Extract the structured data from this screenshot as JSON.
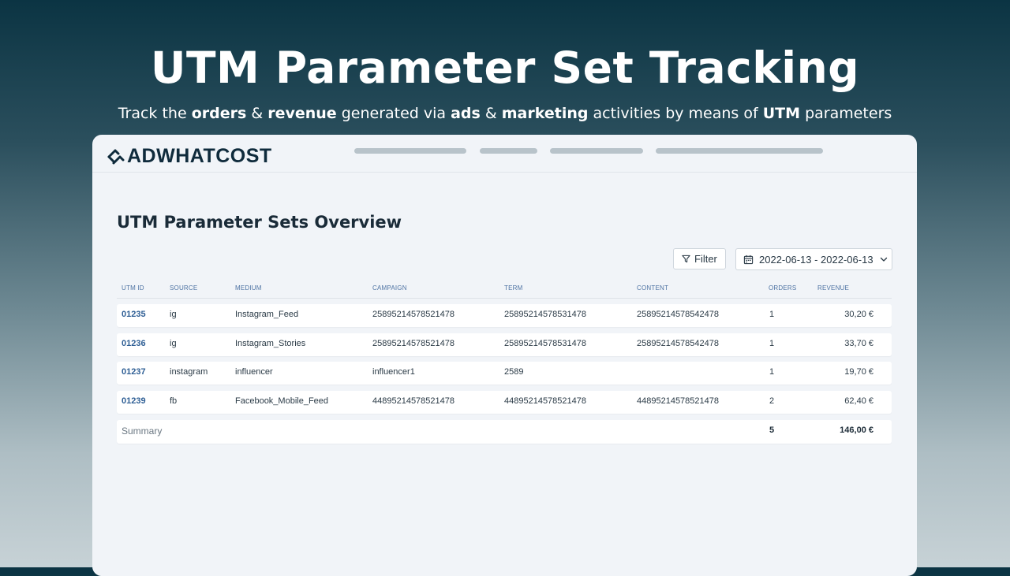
{
  "hero": {
    "title": "UTM Parameter Set Tracking",
    "subtitle_parts": [
      {
        "text": "Track the ",
        "bold": false
      },
      {
        "text": "orders",
        "bold": true
      },
      {
        "text": " & ",
        "bold": false
      },
      {
        "text": "revenue",
        "bold": true
      },
      {
        "text": " generated via ",
        "bold": false
      },
      {
        "text": "ads",
        "bold": true
      },
      {
        "text": " & ",
        "bold": false
      },
      {
        "text": "marketing",
        "bold": true
      },
      {
        "text": " activities by means of ",
        "bold": false
      },
      {
        "text": "UTM",
        "bold": true
      },
      {
        "text": " parameters",
        "bold": false
      }
    ]
  },
  "app": {
    "logo_text": "ADWHATCOST",
    "logo_icon": "adwhatcost-logo-icon"
  },
  "page": {
    "title": "UTM Parameter Sets Overview",
    "filter_label": "Filter",
    "date_range": "2022-06-13 - 2022-06-13"
  },
  "table": {
    "columns": [
      "UTM ID",
      "SOURCE",
      "MEDIUM",
      "CAMPAIGN",
      "TERM",
      "CONTENT",
      "ORDERS",
      "REVENUE"
    ],
    "rows": [
      {
        "id": "01235",
        "source": "ig",
        "medium": "Instagram_Feed",
        "campaign": "25895214578521478",
        "term": "25895214578531478",
        "content": "25895214578542478",
        "orders": "1",
        "revenue": "30,20 €"
      },
      {
        "id": "01236",
        "source": "ig",
        "medium": "Instagram_Stories",
        "campaign": "25895214578521478",
        "term": "25895214578531478",
        "content": "25895214578542478",
        "orders": "1",
        "revenue": "33,70 €"
      },
      {
        "id": "01237",
        "source": "instagram",
        "medium": "influencer",
        "campaign": "influencer1",
        "term": "2589",
        "content": "",
        "orders": "1",
        "revenue": "19,70 €"
      },
      {
        "id": "01239",
        "source": "fb",
        "medium": "Facebook_Mobile_Feed",
        "campaign": "44895214578521478",
        "term": "44895214578521478",
        "content": "44895214578521478",
        "orders": "2",
        "revenue": "62,40 €"
      }
    ],
    "summary": {
      "label": "Summary",
      "orders": "5",
      "revenue": "146,00 €"
    }
  },
  "colors": {
    "accent": "#2f5f95",
    "header_text": "#4e73a3",
    "logo": "#0f2b3c"
  }
}
